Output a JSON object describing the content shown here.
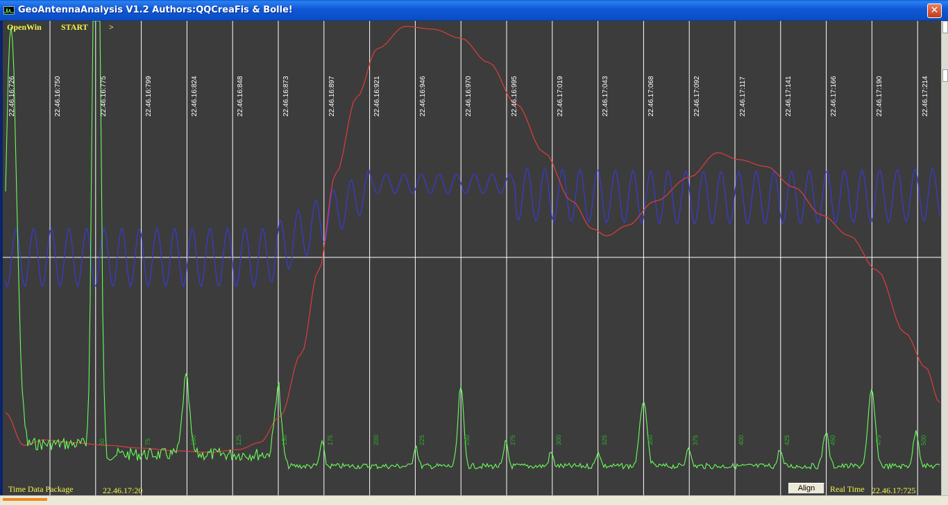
{
  "window": {
    "title": "GeoAntennaAnalysis V1.2 Authors:QQCreaFis & Bolle!",
    "close_glyph": "✕"
  },
  "menu": {
    "openwin": "OpenWin",
    "start": "START",
    "next": ">"
  },
  "time_labels": [
    "22.46.16:726",
    "22.46.16:750",
    "22.46.16:775",
    "22.46.16:799",
    "22.46.16:824",
    "22.46.16:848",
    "22.46.16:873",
    "22.46.16:897",
    "22.46.16:921",
    "22.46.16:946",
    "22.46.16:970",
    "22.46.16:995",
    "22.46.17:019",
    "22.46.17:043",
    "22.46.17:068",
    "22.46.17:092",
    "22.46.17:117",
    "22.46.17:141",
    "22.46.17:166",
    "22.46.17:190",
    "22.46.17:214"
  ],
  "green_values": [
    "50",
    "75",
    "100",
    "125",
    "150",
    "175",
    "200",
    "225",
    "250",
    "275",
    "300",
    "325",
    "350",
    "375",
    "400",
    "425",
    "450",
    "475",
    "500"
  ],
  "status": {
    "time_data_package_label": "Time Data Package",
    "time_data_package_value": "22.46.17:20",
    "align_label": "Align",
    "real_time_label": "Real Time",
    "real_time_value": "22.46.17:725"
  },
  "colors": {
    "background": "#3c3c3c",
    "menu_text": "#f5f54a",
    "grid": "#ffffff",
    "blue_trace": "#3a3ad8",
    "red_trace": "#e03c3c",
    "green_trace": "#6aff5a",
    "green_text": "#2eae2e"
  }
}
